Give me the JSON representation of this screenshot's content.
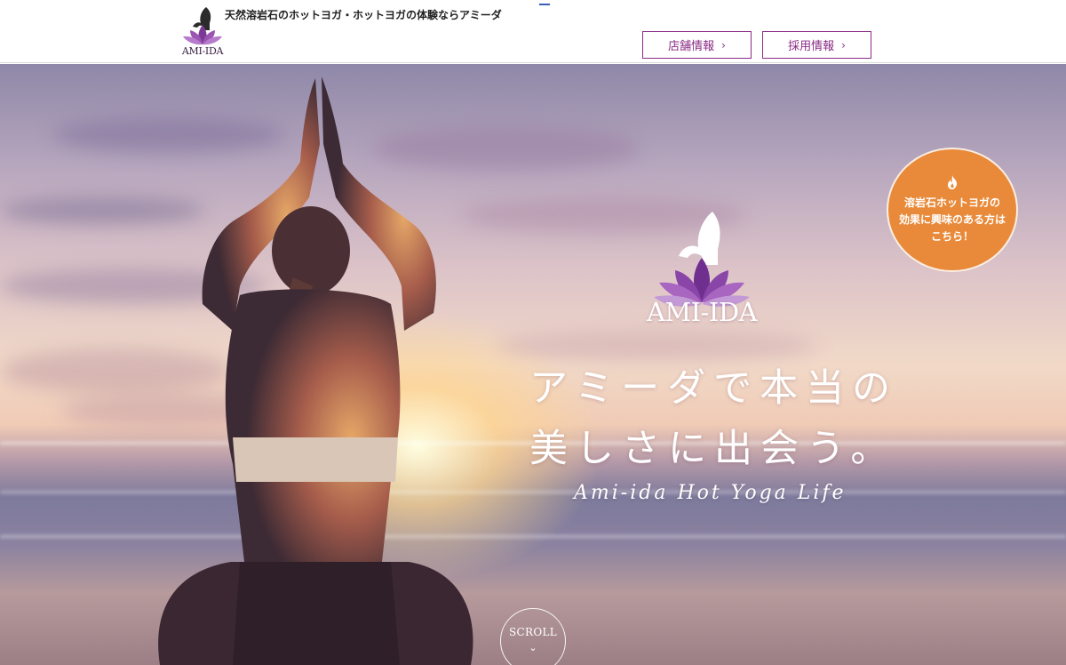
{
  "header": {
    "logo_text": "AMI-IDA",
    "tagline": "天然溶岩石のホットヨガ・ホットヨガの体験ならアミーダ",
    "nav": [
      {
        "label": "店舗情報",
        "chevron": "›"
      },
      {
        "label": "採用情報",
        "chevron": "›"
      }
    ]
  },
  "hero": {
    "logo_text": "AMI-IDA",
    "headline_line1": "アミーダで本当の",
    "headline_line2": "美しさに出会う。",
    "subline": "Ami-ida Hot Yoga Life",
    "badge": {
      "icon": "flame-icon",
      "lines": [
        "溶岩石ホットヨガの",
        "効果に興味のある方は",
        "こちら！"
      ]
    },
    "scroll": {
      "label": "SCROLL",
      "chevron": "⌄"
    }
  },
  "colors": {
    "accent_purple": "#8a2b86",
    "badge_orange": "#e88a3a",
    "lotus_purple": "#6f2f8f"
  }
}
